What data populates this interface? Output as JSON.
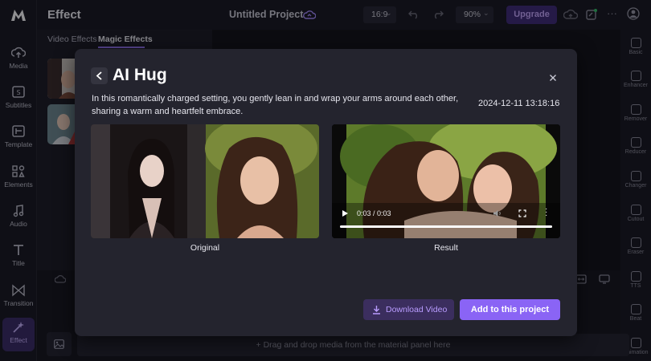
{
  "app": {
    "panel_title": "Effect",
    "project_title": "Untitled Project",
    "aspect_ratio": "16:9",
    "zoom": "90%",
    "upgrade_label": "Upgrade"
  },
  "left_nav": [
    {
      "label": "Media",
      "icon": "cloud-upload-icon"
    },
    {
      "label": "Subtitles",
      "icon": "subtitles-icon"
    },
    {
      "label": "Template",
      "icon": "template-icon"
    },
    {
      "label": "Elements",
      "icon": "elements-icon"
    },
    {
      "label": "Audio",
      "icon": "music-note-icon"
    },
    {
      "label": "Title",
      "icon": "text-t-icon"
    },
    {
      "label": "Transition",
      "icon": "transition-icon"
    },
    {
      "label": "Effect",
      "icon": "magic-wand-icon",
      "active": true
    }
  ],
  "effect_panel": {
    "tabs": [
      "Video Effects",
      "Magic Effects"
    ],
    "selected_tab": "Magic Effects"
  },
  "right_tools": [
    "Basic",
    "Enhancer",
    "Remover",
    "Reducer",
    "Changer",
    "Cutout",
    "Eraser",
    "TTS",
    "Beat",
    "Animation"
  ],
  "timeline": {
    "dropzone_text": "+ Drag and drop media from the material panel here"
  },
  "modal": {
    "title": "AI Hug",
    "description": "In this romantically charged setting, you gently lean in and wrap your arms around each other, sharing a warm and heartfelt embrace.",
    "timestamp": "2024-12-11 13:18:16",
    "original_caption": "Original",
    "result_caption": "Result",
    "video_time": "0:03 / 0:03",
    "video_progress": 1.0,
    "download_label": "Download Video",
    "add_label": "Add to this project"
  },
  "colors": {
    "accent": "#8a64f5",
    "upgrade_bg": "#3e2a78",
    "modal_bg": "#24242e"
  }
}
